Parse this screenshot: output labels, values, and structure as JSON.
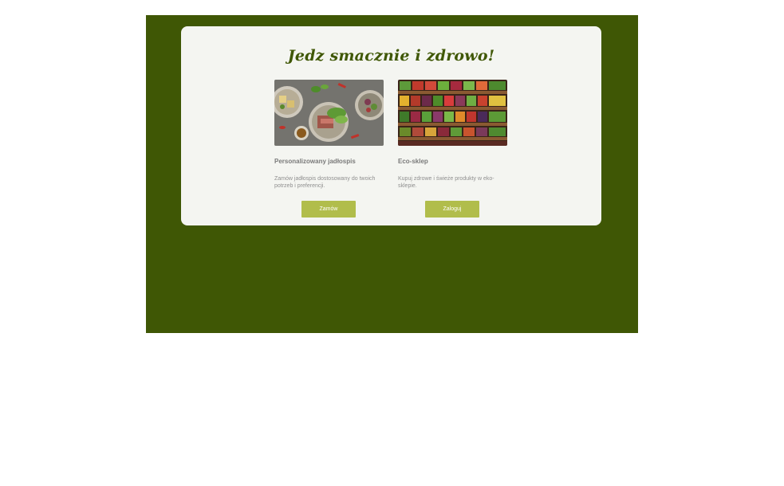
{
  "card": {
    "title": "Jedz smacznie i zdrowo!"
  },
  "offers": [
    {
      "title": "Personalizowany jadłospis",
      "description": "Zamów jadłospis dostosowany do twoich potrzeb i preferencji.",
      "button_label": "Zamów",
      "image": "food-plates-photo"
    },
    {
      "title": "Eco-sklep",
      "description": "Kupuj zdrowe i świeże produkty w eko-sklepie.",
      "button_label": "Zaloguj",
      "image": "vegetable-shelves-photo"
    }
  ],
  "colors": {
    "background": "#3f5705",
    "card": "#f4f5f1",
    "button": "#b1bd4b",
    "title": "#3f5705"
  }
}
